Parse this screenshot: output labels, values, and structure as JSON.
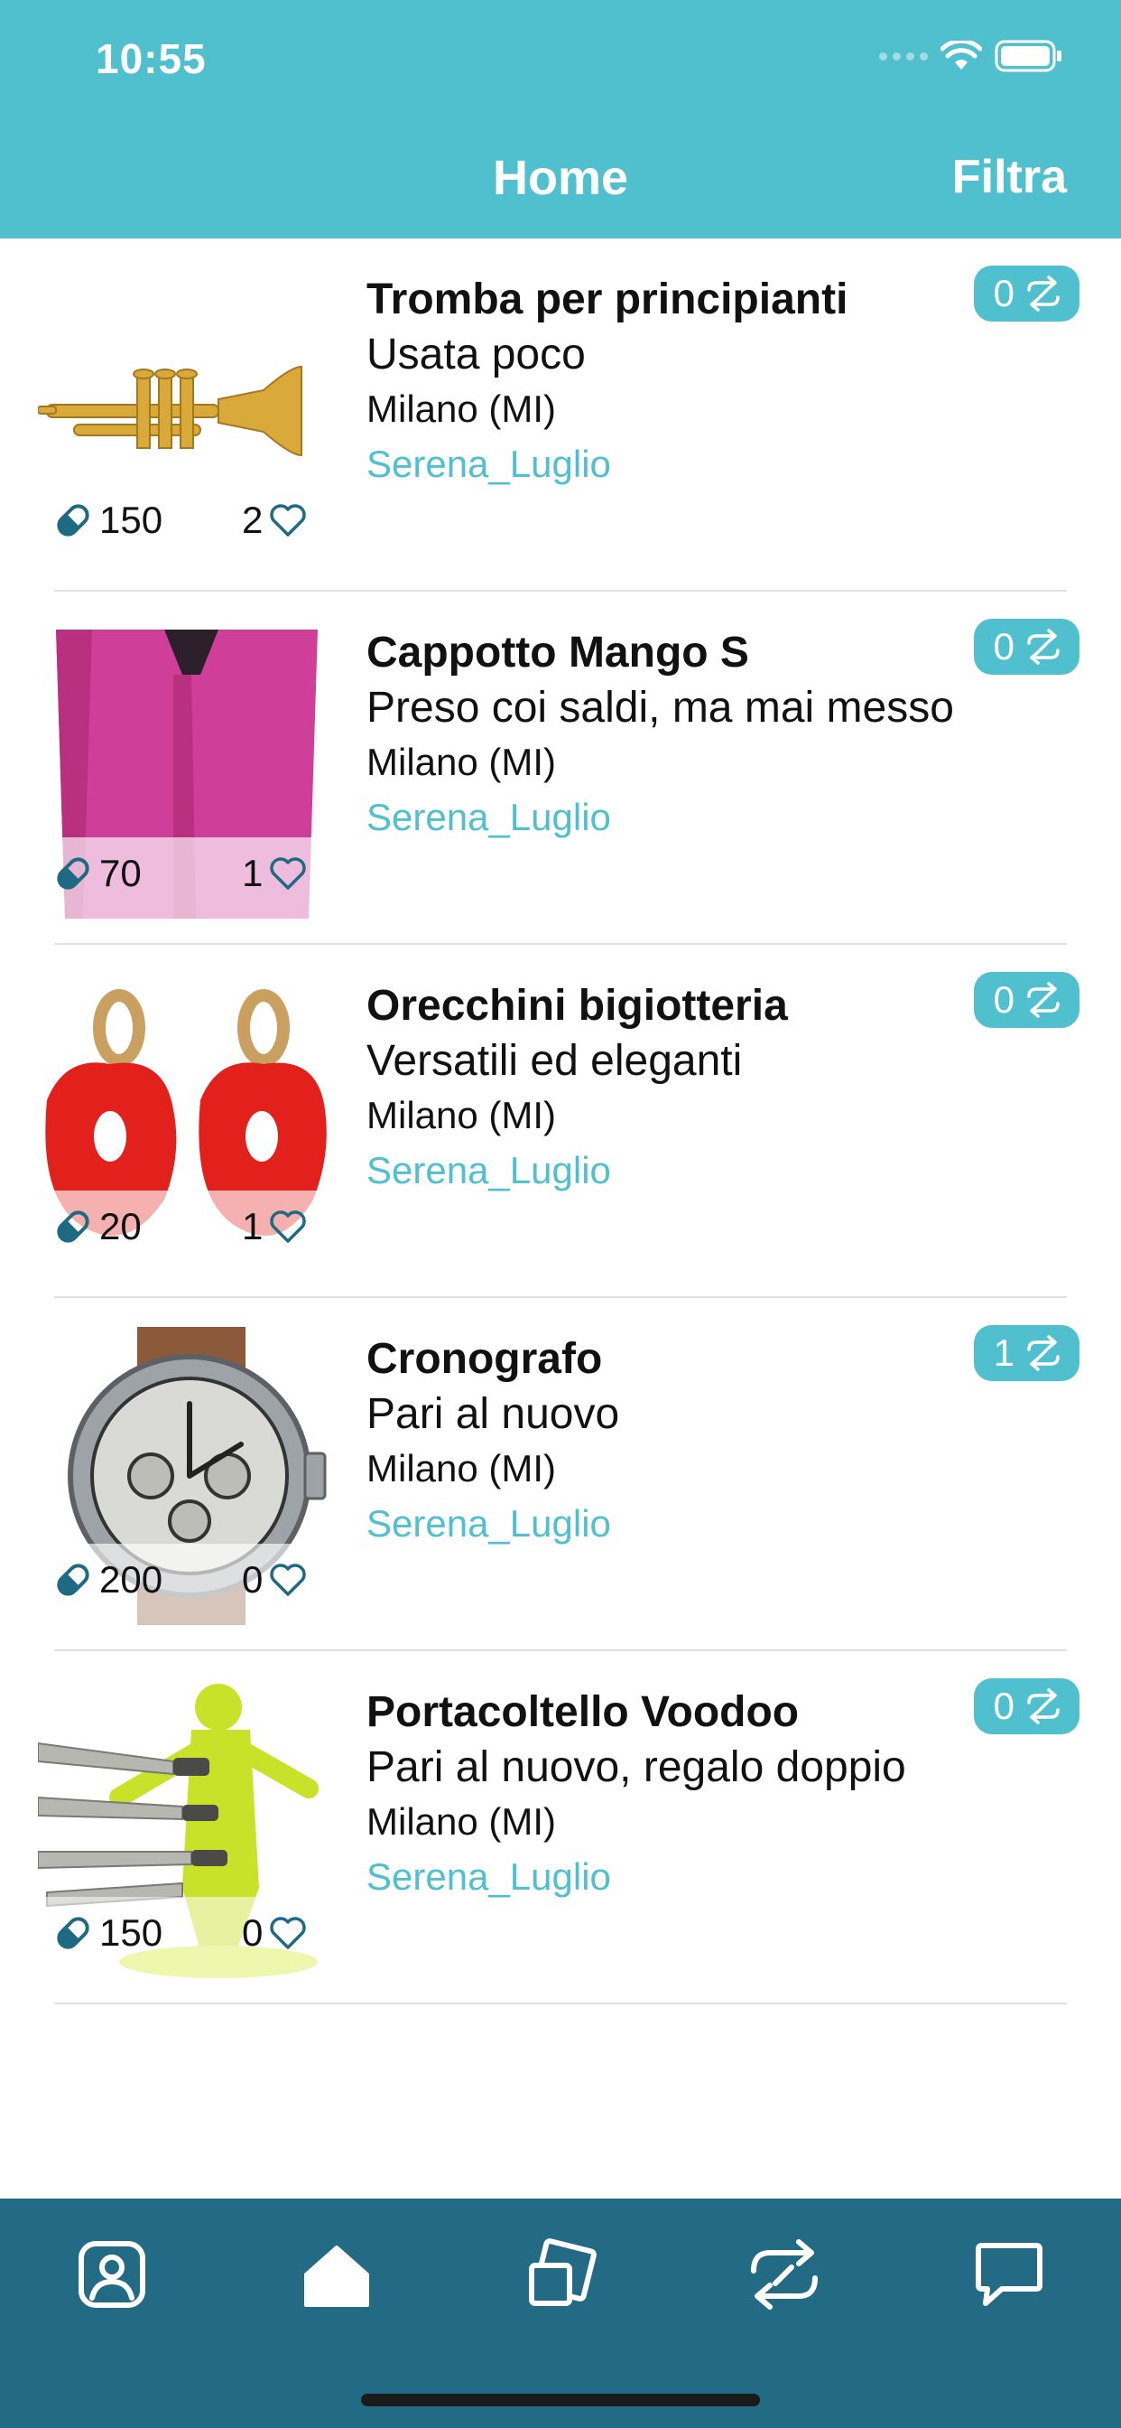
{
  "status_bar": {
    "time": "10:55"
  },
  "header": {
    "title": "Home",
    "filter_label": "Filtra"
  },
  "colors": {
    "accent": "#50c0ce",
    "tabbar": "#236a84",
    "price_icon": "#1e6a82"
  },
  "items": [
    {
      "title": "Tromba per principianti",
      "subtitle": "Usata poco",
      "location": "Milano (MI)",
      "user": "Serena_Luglio",
      "price": "150",
      "likes": "2",
      "swaps": "0",
      "image": "trumpet-image"
    },
    {
      "title": "Cappotto Mango S",
      "subtitle": "Preso coi saldi, ma mai messo",
      "location": "Milano (MI)",
      "user": "Serena_Luglio",
      "price": "70",
      "likes": "1",
      "swaps": "0",
      "image": "pink-coat-image"
    },
    {
      "title": "Orecchini bigiotteria",
      "subtitle": "Versatili ed eleganti",
      "location": "Milano (MI)",
      "user": "Serena_Luglio",
      "price": "20",
      "likes": "1",
      "swaps": "0",
      "image": "red-earrings-image"
    },
    {
      "title": "Cronografo",
      "subtitle": "Pari al nuovo",
      "location": "Milano (MI)",
      "user": "Serena_Luglio",
      "price": "200",
      "likes": "0",
      "swaps": "1",
      "image": "chronograph-watch-image"
    },
    {
      "title": "Portacoltello Voodoo",
      "subtitle": "Pari al nuovo, regalo doppio",
      "location": "Milano (MI)",
      "user": "Serena_Luglio",
      "price": "150",
      "likes": "0",
      "swaps": "0",
      "image": "voodoo-knife-block-image"
    }
  ],
  "tabbar": {
    "tabs": [
      "profile-icon",
      "home-icon",
      "items-icon",
      "swap-icon",
      "chat-icon"
    ],
    "active": "home-icon"
  }
}
